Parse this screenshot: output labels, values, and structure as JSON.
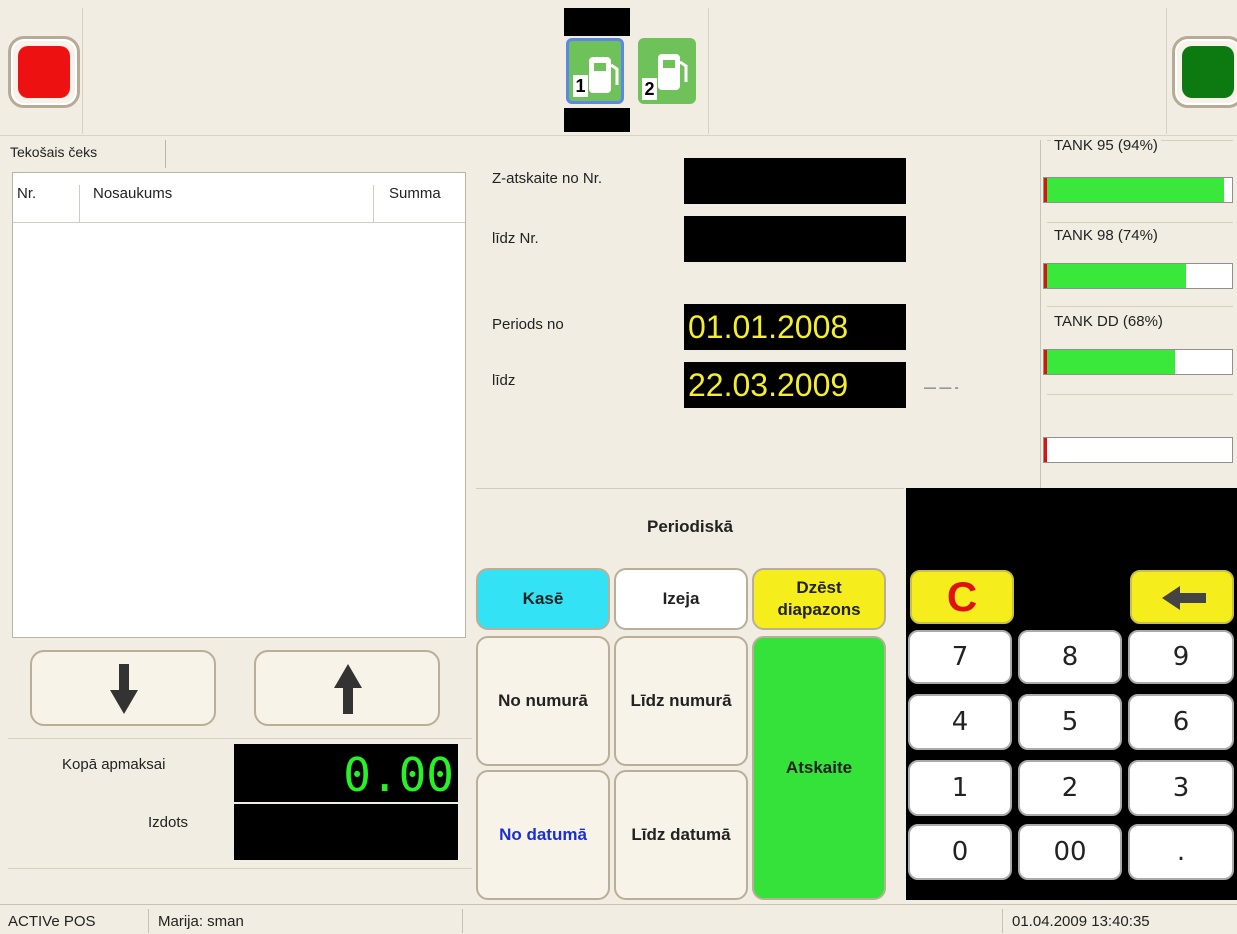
{
  "topbar": {
    "left_button": {
      "icon": "stop-square-icon",
      "color": "#ee1111"
    },
    "right_button": {
      "icon": "go-square-icon",
      "color": "#0c7a10"
    },
    "pumps": [
      {
        "number": "1",
        "selected": true
      },
      {
        "number": "2",
        "selected": false
      }
    ]
  },
  "receipt": {
    "tab_label": "Tekošais čeks",
    "columns": [
      "Nr.",
      "Nosaukums",
      "Summa"
    ],
    "rows": [],
    "total_label": "Kopā apmaksai",
    "total_value": "0.00",
    "change_label": "Izdots",
    "change_value": ""
  },
  "report_form": {
    "z_from_label": "Z-atskaite no Nr.",
    "z_from_value": "",
    "z_to_label": "līdz Nr.",
    "z_to_value": "",
    "period_from_label": "Periods no",
    "period_from_value": "01.01.2008",
    "period_to_label": "līdz",
    "period_to_value": "22.03.2009",
    "dash_text": "— — -"
  },
  "tanks": [
    {
      "label": "TANK 95 (94%)",
      "level": 0.94
    },
    {
      "label": "TANK 98 (74%)",
      "level": 0.74
    },
    {
      "label": "TANK DD (68%)",
      "level": 0.68
    },
    {
      "label": "",
      "level": 0.0
    }
  ],
  "mode_label": "Periodiskā",
  "buttons": {
    "kase": "Kasē",
    "izeja": "Izeja",
    "dzest": "Dzēst diapazons",
    "no_numura": "No numurā",
    "lidz_numura": "Līdz numurā",
    "no_datuma": "No datumā",
    "lidz_datuma": "Līdz datumā",
    "atskaite": "Atskaite"
  },
  "keypad": {
    "clear": "C",
    "keys": [
      "7",
      "8",
      "9",
      "4",
      "5",
      "6",
      "1",
      "2",
      "3",
      "0",
      "00",
      "."
    ]
  },
  "statusbar": {
    "app": "ACTIVe POS",
    "user": "Marija: sman",
    "datetime": "01.04.2009 13:40:35"
  },
  "colors": {
    "background": "#f1ede2",
    "kase_button": "#33e3f5",
    "dzest_button": "#f5ee1c",
    "atskaite_button": "#35e23a",
    "total_digits": "#27f127",
    "date_digits": "#f4ef2c",
    "no_datuma_text": "#1a2fd0"
  }
}
